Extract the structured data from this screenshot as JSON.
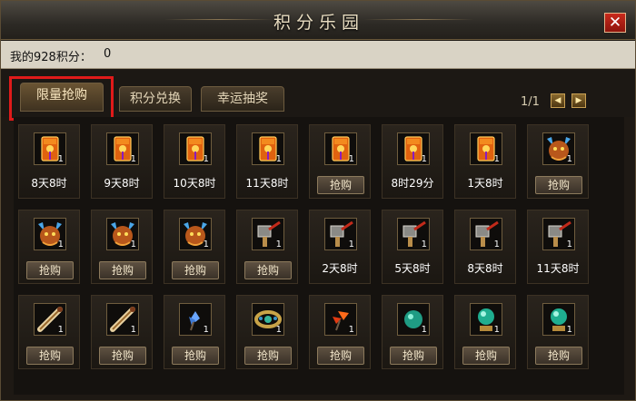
{
  "window": {
    "title": "积分乐园",
    "close_glyph": "✕"
  },
  "points": {
    "label": "我的928积分：",
    "value": "0"
  },
  "tabs": [
    {
      "label": "限量抢购",
      "active": true
    },
    {
      "label": "积分兑换",
      "active": false
    },
    {
      "label": "幸运抽奖",
      "active": false
    }
  ],
  "pager": {
    "text": "1/1",
    "prev_glyph": "◀",
    "next_glyph": "▶"
  },
  "buy_label": "抢购",
  "items": [
    {
      "icon": "red-envelope-icon",
      "qty": "1",
      "label": "8天8时"
    },
    {
      "icon": "red-envelope-icon",
      "qty": "1",
      "label": "9天8时"
    },
    {
      "icon": "red-envelope-icon",
      "qty": "1",
      "label": "10天8时"
    },
    {
      "icon": "red-envelope-icon",
      "qty": "1",
      "label": "11天8时"
    },
    {
      "icon": "red-envelope-icon",
      "qty": "1",
      "label": ""
    },
    {
      "icon": "red-envelope-icon",
      "qty": "1",
      "label": "8时29分"
    },
    {
      "icon": "red-envelope-icon",
      "qty": "1",
      "label": "1天8时"
    },
    {
      "icon": "demon-armor-icon",
      "qty": "1",
      "label": ""
    },
    {
      "icon": "demon-armor-icon",
      "qty": "1",
      "label": ""
    },
    {
      "icon": "demon-armor-icon",
      "qty": "1",
      "label": ""
    },
    {
      "icon": "demon-armor-icon",
      "qty": "1",
      "label": ""
    },
    {
      "icon": "hammer-icon",
      "qty": "1",
      "label": ""
    },
    {
      "icon": "hammer-icon",
      "qty": "1",
      "label": "2天8时"
    },
    {
      "icon": "hammer-icon",
      "qty": "1",
      "label": "5天8时"
    },
    {
      "icon": "hammer-icon",
      "qty": "1",
      "label": "8天8时"
    },
    {
      "icon": "hammer-icon",
      "qty": "1",
      "label": "11天8时"
    },
    {
      "icon": "scroll-icon",
      "qty": "1",
      "label": ""
    },
    {
      "icon": "scroll-icon",
      "qty": "1",
      "label": ""
    },
    {
      "icon": "blue-flower-icon",
      "qty": "1",
      "label": ""
    },
    {
      "icon": "jade-belt-icon",
      "qty": "1",
      "label": ""
    },
    {
      "icon": "red-flower-icon",
      "qty": "1",
      "label": ""
    },
    {
      "icon": "jade-orb-icon",
      "qty": "1",
      "label": ""
    },
    {
      "icon": "jade-orb-stand-icon",
      "qty": "1",
      "label": ""
    },
    {
      "icon": "jade-orb-stand-icon",
      "qty": "1",
      "label": ""
    }
  ],
  "colors": {
    "highlight": "#e01a1a",
    "close_bg": "#c82a1c"
  }
}
